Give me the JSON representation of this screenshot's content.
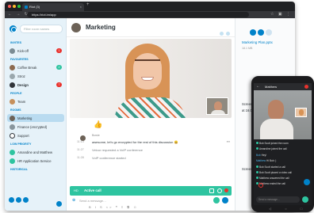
{
  "browser": {
    "tab_title": "Riot (3)",
    "tab_close": "×",
    "new_tab": "+",
    "url": "https://riot.im/app",
    "nav_icons": "← → ↻",
    "ext_icons": "☆ ▣ ⋮"
  },
  "sidebar": {
    "search_placeholder": "Filter room names",
    "sections": {
      "invites": "INVITES",
      "favourites": "FAVOURITES",
      "people": "PEOPLE",
      "rooms": "ROOMS",
      "low_priority": "LOW PRIORITY",
      "historical": "HISTORICAL"
    },
    "items": [
      {
        "label": "Kick-off",
        "badge": "1"
      },
      {
        "label": "Coffee Break",
        "badge": "2"
      },
      {
        "label": "Stroz",
        "badge": ""
      },
      {
        "label": "Design",
        "badge": "7"
      },
      {
        "label": "Team",
        "badge": ""
      },
      {
        "label": "Marketing",
        "badge": ""
      },
      {
        "label": "Finance (encrypted)",
        "badge": ""
      },
      {
        "label": "Support",
        "badge": ""
      },
      {
        "label": "Amandine and Matthew",
        "badge": ""
      },
      {
        "label": "HR Application Service",
        "badge": ""
      }
    ]
  },
  "header": {
    "room_name": "Marketing"
  },
  "reaction": "👍",
  "timeline": {
    "author": "Bowie",
    "messages": [
      {
        "time": "11:14",
        "text": "awesome, let's go encrypted for the rest of this discussion 😀",
        "system": false
      },
      {
        "time": "11:27",
        "text": "Velour requested a VoIP conference",
        "system": true
      },
      {
        "time": "11:28",
        "text": "VoIP conference started",
        "system": true
      }
    ]
  },
  "call": {
    "quality": "HD",
    "title": "Active call"
  },
  "composer": {
    "attach": "⊕",
    "placeholder": "Send a message…",
    "format_bar": "B I S <> ❝ ≡ ⧉ ☺"
  },
  "right_panel": {
    "title": "Marketing Plan.pptx",
    "subtitle": "18.1 MB",
    "files": [
      "Screen Sh…",
      "at 16.01.1…",
      "Screen Sh…"
    ]
  },
  "phone": {
    "back": "←",
    "room": "Matthew",
    "messages": [
      {
        "who": "",
        "text": "Bob Scott joined the room"
      },
      {
        "who": "",
        "text": "Amandine joined the call"
      },
      {
        "who": "Bob",
        "text": "Hey!"
      },
      {
        "who": "Matthew",
        "text": "Hi Bob :)"
      },
      {
        "who": "",
        "text": "Bob Scott started a call"
      },
      {
        "who": "",
        "text": "Bob Scott placed a video call"
      },
      {
        "who": "",
        "text": "Matthew answered the call"
      },
      {
        "who": "",
        "text": "Matthew ended the call"
      }
    ],
    "input_placeholder": "Send a message…",
    "nav": "◁ ○ □"
  },
  "colors": {
    "accent": "#0082c9",
    "call_green": "#2ec4a0",
    "badge_red": "#e9322d",
    "sidebar_bg": "#e6f2f9"
  }
}
